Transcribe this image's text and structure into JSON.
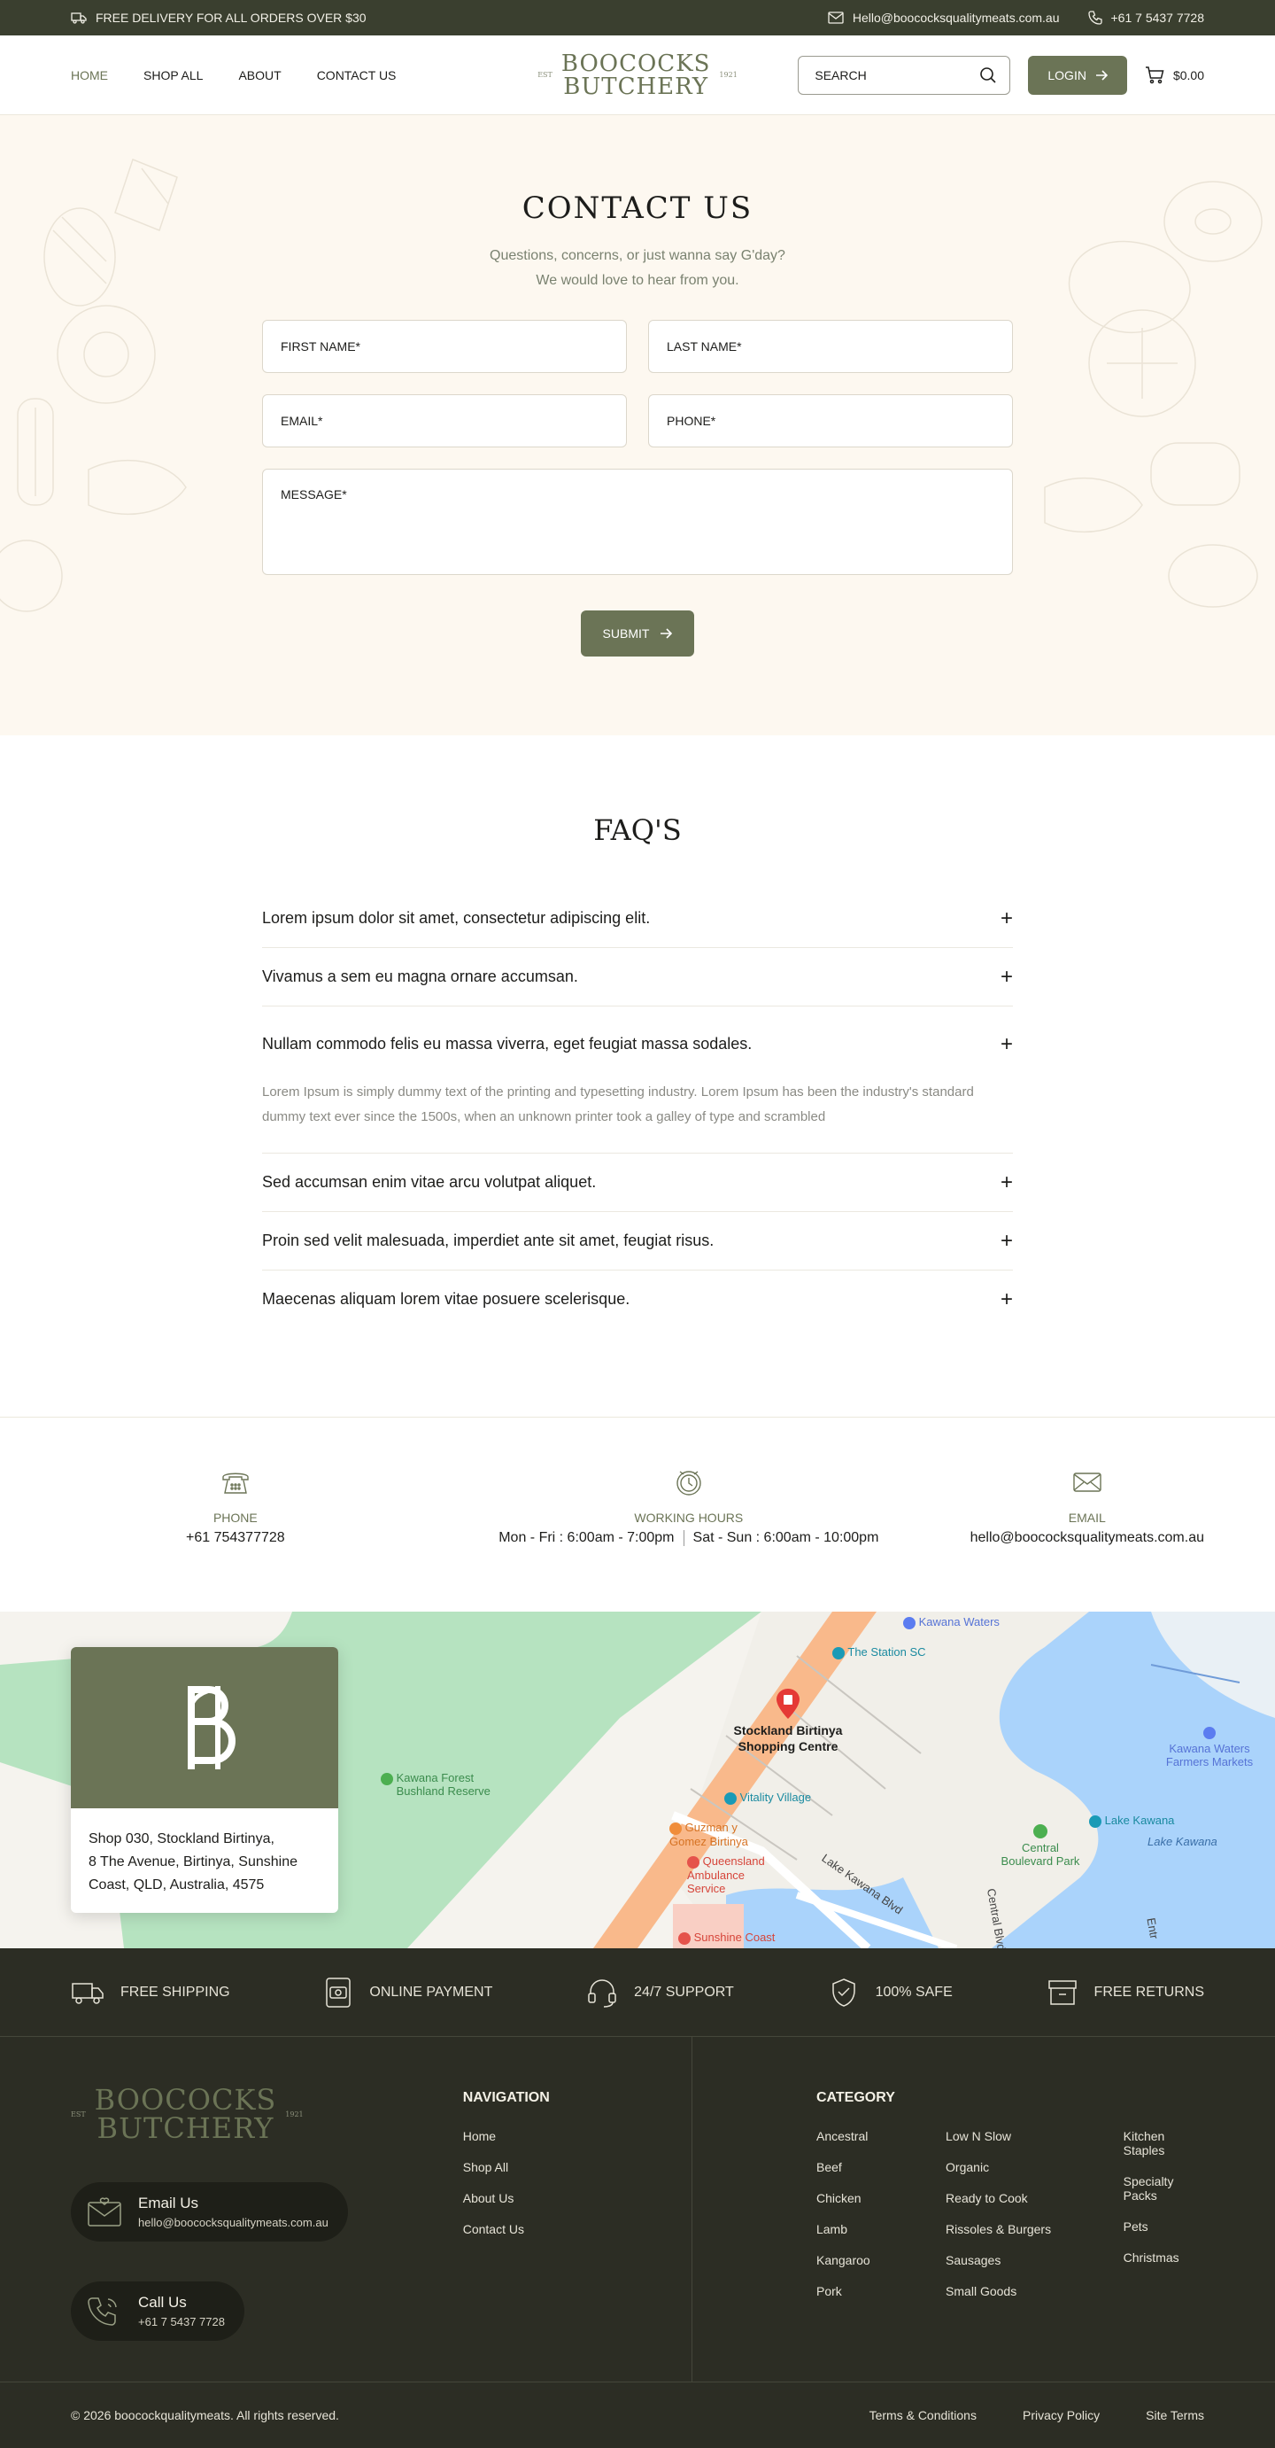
{
  "topbar": {
    "delivery": "FREE DELIVERY FOR ALL ORDERS OVER $30",
    "email": "Hello@boococksqualitymeats.com.au",
    "phone": "+61 7 5437 7728"
  },
  "header": {
    "nav": [
      "HOME",
      "SHOP ALL",
      "ABOUT",
      "CONTACT US"
    ],
    "logo_top": "BOOCOCKS",
    "logo_bottom": "BUTCHERY",
    "logo_est": "EST",
    "logo_year": "1921",
    "search_placeholder": "SEARCH",
    "login": "LOGIN",
    "cart_total": "$0.00"
  },
  "contact": {
    "title": "CONTACT US",
    "subtitle_1": "Questions, concerns, or just wanna say G'day?",
    "subtitle_2": "We would love to hear from you.",
    "first_name": "FIRST NAME*",
    "last_name": "LAST NAME*",
    "email": "EMAIL*",
    "phone": "PHONE*",
    "message": "MESSAGE*",
    "submit": "SUBMIT"
  },
  "faq": {
    "title": "FAQ'S",
    "items": [
      {
        "q": "Lorem ipsum dolor sit amet, consectetur adipiscing elit."
      },
      {
        "q": "Vivamus a sem eu magna ornare accumsan."
      },
      {
        "q": "Nullam commodo felis eu massa viverra, eget feugiat massa sodales.",
        "a": "Lorem Ipsum is simply dummy text of the printing and typesetting industry. Lorem Ipsum has been the industry's standard dummy text ever since the 1500s, when an unknown printer took a galley of type and scrambled"
      },
      {
        "q": "Sed accumsan enim vitae arcu volutpat aliquet."
      },
      {
        "q": "Proin sed velit malesuada, imperdiet ante sit amet, feugiat risus."
      },
      {
        "q": "Maecenas aliquam lorem vitae posuere scelerisque."
      }
    ]
  },
  "info": {
    "phone_label": "PHONE",
    "phone_value": "+61 754377728",
    "hours_label": "WORKING HOURS",
    "hours_weekday": "Mon - Fri : 6:00am - 7:00pm",
    "hours_weekend": "Sat - Sun : 6:00am - 10:00pm",
    "email_label": "EMAIL",
    "email_value": "hello@boococksqualitymeats.com.au"
  },
  "map": {
    "address_1": "Shop 030, Stockland Birtinya,",
    "address_2": "8 The Avenue, Birtinya, Sunshine",
    "address_3": "Coast, QLD, Australia, 4575",
    "labels": {
      "stockland": "Stockland Birtinya Shopping Centre",
      "kawana_forest": "Kawana Forest Bushland Reserve",
      "station_sc": "The Station SC",
      "kawana_waters": "Kawana Waters",
      "vitality": "Vitality Village",
      "guzman": "Guzman y Gomez Birtinya",
      "ambulance": "Queensland Ambulance Service",
      "sunshine": "Sunshine Coast",
      "lake_kawana_blvd": "Lake Kawana Blvd",
      "central_park": "Central Boulevard Park",
      "lake_kawana_pin": "Lake Kawana",
      "lake_kawana": "Lake Kawana",
      "farmers": "Kawana Waters Farmers Markets",
      "central_blvd": "Central Blvd",
      "entrance": "Entr"
    }
  },
  "footer": {
    "features": [
      "FREE SHIPPING",
      "ONLINE PAYMENT",
      "24/7 SUPPORT",
      "100% SAFE",
      "FREE RETURNS"
    ],
    "email_title": "Email Us",
    "email_value": "hello@boococksqualitymeats.com.au",
    "call_title": "Call Us",
    "call_value": "+61 7 5437 7728",
    "nav_heading": "NAVIGATION",
    "nav_links": [
      "Home",
      "Shop All",
      "About Us",
      "Contact Us"
    ],
    "cat_heading": "CATEGORY",
    "cat_col1": [
      "Ancestral",
      "Beef",
      "Chicken",
      "Lamb",
      "Kangaroo",
      "Pork"
    ],
    "cat_col2": [
      "Low N Slow",
      "Organic",
      "Ready to Cook",
      "Rissoles & Burgers",
      "Sausages",
      "Small Goods"
    ],
    "cat_col3": [
      "Kitchen Staples",
      "Specialty Packs",
      "Pets",
      "Christmas"
    ],
    "copyright": "© 2026 boocockqualitymeats. All rights reserved.",
    "terms": "Terms & Conditions",
    "privacy": "Privacy Policy",
    "site_terms": "Site Terms"
  },
  "colors": {
    "olive": "#6b7456",
    "dark": "#2c2d24",
    "topbar": "#3a3f2f",
    "cream": "#fdf8f0"
  }
}
